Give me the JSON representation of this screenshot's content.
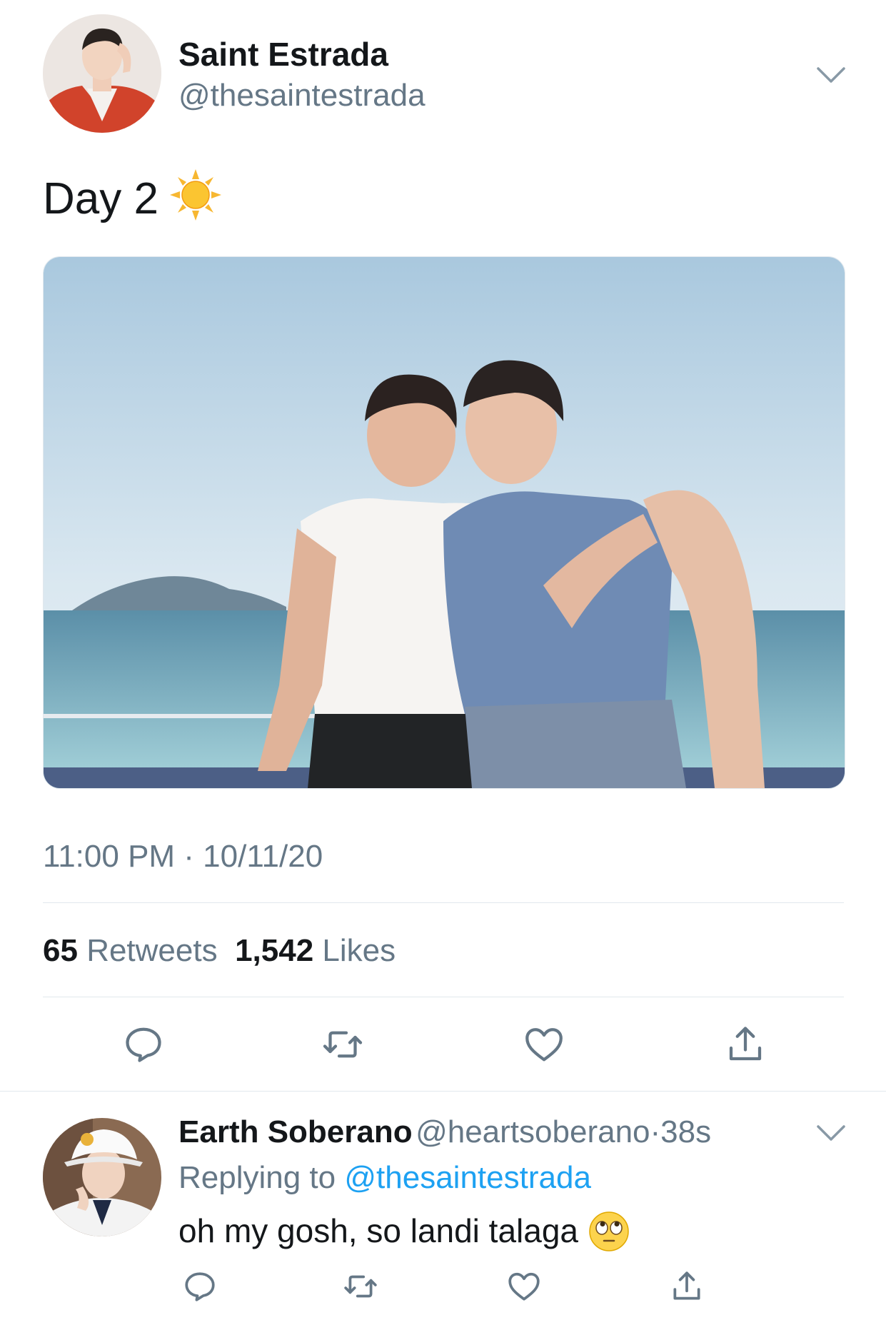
{
  "tweet": {
    "author": {
      "display_name": "Saint Estrada",
      "handle": "@thesaintestrada"
    },
    "text": "Day 2",
    "text_emoji": "sun-emoji",
    "timestamp": "11:00 PM · 10/11/20",
    "stats": {
      "retweets_count": "65",
      "retweets_label": "Retweets",
      "likes_count": "1,542",
      "likes_label": "Likes"
    },
    "actions": [
      "reply-icon",
      "retweet-icon",
      "like-icon",
      "share-icon"
    ]
  },
  "reply": {
    "author": {
      "display_name": "Earth Soberano",
      "handle": "@heartsoberano",
      "separator": "·",
      "age": "38s"
    },
    "replying_prefix": "Replying to",
    "replying_to": "@thesaintestrada",
    "text": "oh my gosh, so landi talaga",
    "text_emoji": "face-with-rolling-eyes-emoji",
    "actions": [
      "reply-icon",
      "retweet-icon",
      "like-icon",
      "share-icon"
    ]
  },
  "colors": {
    "text": "#14171a",
    "secondary": "#657786",
    "link": "#1da1f2",
    "divider": "#e1e8ed"
  }
}
